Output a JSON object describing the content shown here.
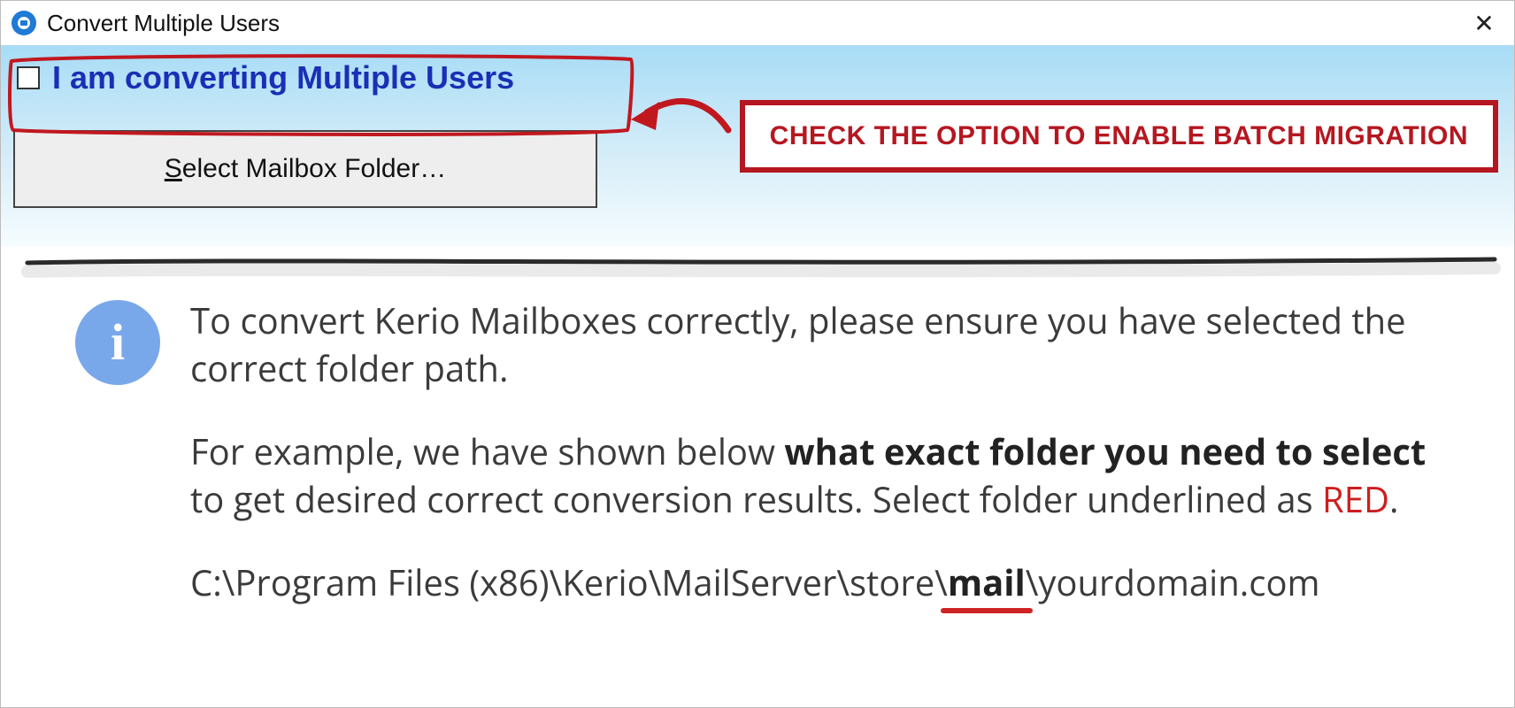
{
  "window": {
    "title": "Convert Multiple Users"
  },
  "checkbox": {
    "label": "I am converting Multiple Users"
  },
  "buttons": {
    "select_mailbox_prefix": "S",
    "select_mailbox_rest": "elect Mailbox Folder…"
  },
  "callout": {
    "text": "CHECK THE OPTION TO ENABLE BATCH MIGRATION"
  },
  "info": {
    "p1": "To convert Kerio Mailboxes correctly, please ensure you have selected the correct folder path.",
    "p2a": "For example, we have shown below ",
    "p2b_bold": "what exact folder you need to select",
    "p2c": " to get desired correct conversion results. Select folder underlined as ",
    "p2d_red": "RED",
    "p2e": ".",
    "path_pre": "C:\\Program Files (x86)\\Kerio\\MailServer\\store\\",
    "path_mail": "mail",
    "path_post": "\\yourdomain.com"
  }
}
